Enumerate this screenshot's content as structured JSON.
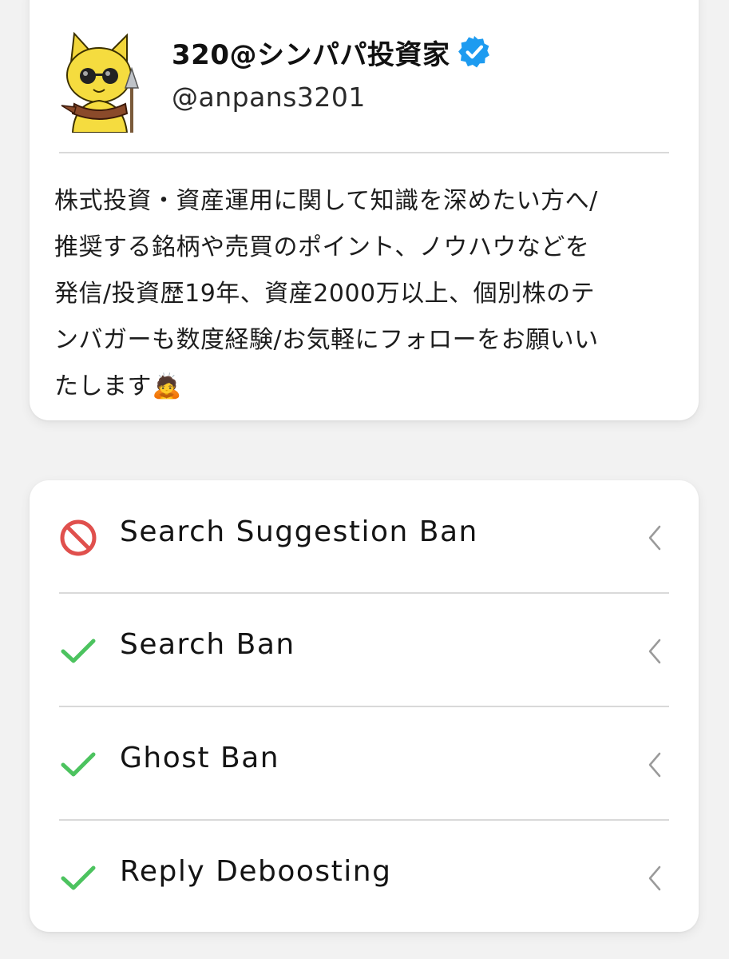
{
  "profile": {
    "display_name": "320@シンパパ投資家",
    "verified": true,
    "handle": "@anpans3201",
    "bio": "株式投資・資産運用に関して知識を深めたい方へ/\n推奨する銘柄や売買のポイント、ノウハウなどを\n発信/投資歴19年、資産2000万以上、個別株のテ\nンバガーも数度経験/お気軽にフォローをお願いい\nたします🙇",
    "avatar_icon": "cat-avatar-icon"
  },
  "checks": [
    {
      "label": "Search Suggestion Ban",
      "status": "banned",
      "icon": "prohibited-icon"
    },
    {
      "label": "Search Ban",
      "status": "ok",
      "icon": "checkmark-icon"
    },
    {
      "label": "Ghost Ban",
      "status": "ok",
      "icon": "checkmark-icon"
    },
    {
      "label": "Reply Deboosting",
      "status": "ok",
      "icon": "checkmark-icon"
    }
  ],
  "colors": {
    "verified": "#1d9bf0",
    "banned": "#e0504d",
    "ok": "#4cc35f",
    "chevron": "#9a9a9a",
    "background": "#f2f2f2",
    "card": "#ffffff"
  }
}
